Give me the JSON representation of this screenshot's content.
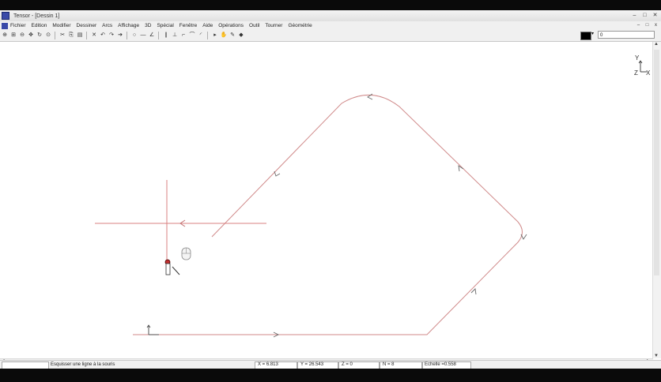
{
  "window": {
    "title": "Tensor - [Dessin 1]",
    "controls": [
      "–",
      "□",
      "✕"
    ],
    "mdi_controls": [
      "–",
      "□",
      "x"
    ]
  },
  "menu": {
    "items": [
      "Fichier",
      "Edition",
      "Modifier",
      "Dessiner",
      "Arcs",
      "Affichage",
      "3D",
      "Spécial",
      "Fenêtre",
      "Aide",
      "Opérations",
      "Outil",
      "Tourner",
      "Géométrie"
    ]
  },
  "toolbar": {
    "buttons": [
      "zoom-in",
      "zoom-window",
      "zoom-out",
      "pan",
      "rotate",
      "zoom-all",
      "cut",
      "copy",
      "paste",
      "delete",
      "undo",
      "redo",
      "arrow-right",
      "circle",
      "line",
      "angle",
      "parallel",
      "perpendicular",
      "corner",
      "arc-corner",
      "arc",
      "pointer",
      "move",
      "erase-tool",
      "snap"
    ],
    "glyphs": [
      "⊕",
      "⊞",
      "⊖",
      "✥",
      "↻",
      "⊙",
      "✂",
      "⎘",
      "▤",
      "✕",
      "↶",
      "↷",
      "➔",
      "○",
      "—",
      "∠",
      "∥",
      "⊥",
      "⌐",
      "⌒",
      "◜",
      "▸",
      "✋",
      "✎",
      "◆"
    ],
    "line_weight_value": "0"
  },
  "status": {
    "message": "Esquisser une ligne à la souris",
    "x": "X = 6.813",
    "y": "Y = 26.543",
    "z": "Z = 0",
    "n": "N = 8",
    "scale": "Echelle =0.558"
  },
  "axes": {
    "y_label": "Y",
    "z_label": "Z",
    "x_label": "X"
  },
  "colors": {
    "path": "#d08a8a",
    "crosshair": "#d98080",
    "arrows": "#6a6a6a"
  }
}
